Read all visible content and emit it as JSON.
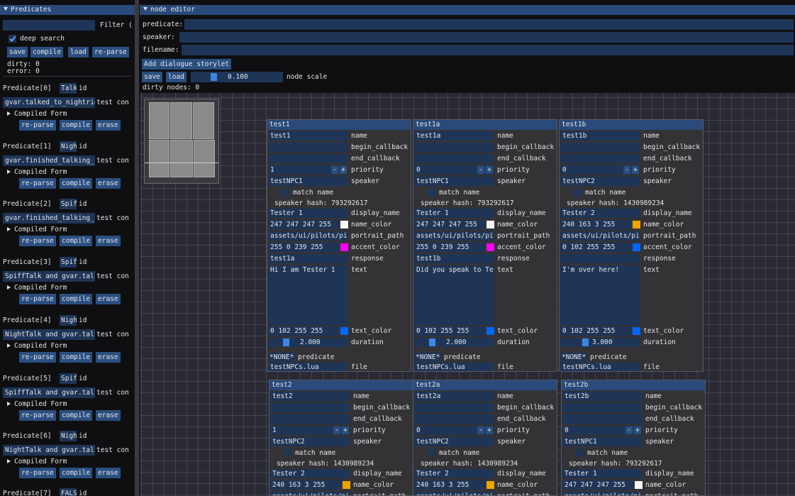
{
  "left": {
    "title": "Predicates",
    "filter_label": "Filter (",
    "deep_search": "deep search",
    "buttons": [
      "save",
      "compile",
      "load",
      "re-parse"
    ],
    "dirty": "dirty: 0",
    "error": "error: 0",
    "predicates": [
      {
        "header": "Predicate[0]",
        "tag": "Talk",
        "id": "id",
        "expr": "gvar.talked_to_nightrid",
        "suffix": "test con",
        "compiled": "Compiled Form"
      },
      {
        "header": "Predicate[1]",
        "tag": "Nigh",
        "id": "id",
        "expr": "gvar.finished_talking_",
        "suffix": "test con",
        "compiled": "Compiled Form"
      },
      {
        "header": "Predicate[2]",
        "tag": "Spif",
        "id": "id",
        "expr": "gvar.finished_talking_",
        "suffix": "test con",
        "compiled": "Compiled Form"
      },
      {
        "header": "Predicate[3]",
        "tag": "Spif",
        "id": "id",
        "expr": "SpiffTalk and gvar.tall",
        "suffix": "test con",
        "compiled": "Compiled Form"
      },
      {
        "header": "Predicate[4]",
        "tag": "Nigh",
        "id": "id",
        "expr": "NightTalk and gvar.tall",
        "suffix": "test con",
        "compiled": "Compiled Form"
      },
      {
        "header": "Predicate[5]",
        "tag": "Spif",
        "id": "id",
        "expr": "SpiffTalk and gvar.tall",
        "suffix": "test con",
        "compiled": "Compiled Form"
      },
      {
        "header": "Predicate[6]",
        "tag": "Nigh",
        "id": "id",
        "expr": "NightTalk and gvar.tall",
        "suffix": "test con",
        "compiled": "Compiled Form"
      },
      {
        "header": "Predicate[7]",
        "tag": "FALS",
        "id": "id"
      }
    ],
    "pred_buttons": [
      "re-parse",
      "compile",
      "erase"
    ]
  },
  "editor": {
    "title": "node editor",
    "predicate_label": "predicate:",
    "speaker_label": "speaker:",
    "filename_label": "filename:",
    "add_button": "Add dialogue storylet",
    "save": "save",
    "load": "load",
    "scale_value": "0.100",
    "scale_label": "node scale",
    "dirty_nodes": "dirty nodes: 0"
  },
  "labels": {
    "name": "name",
    "begin": "begin_callback",
    "end": "end_callback",
    "priority": "priority",
    "speaker": "speaker",
    "match": "match name",
    "display": "display_name",
    "name_color": "name_color",
    "portrait": "portrait_path",
    "accent": "accent_color",
    "response": "response",
    "text": "text",
    "text_color": "text_color",
    "duration": "duration",
    "predicate": "predicate",
    "file": "file",
    "minus": "-",
    "plus": "+"
  },
  "nodes": [
    {
      "title": "test1",
      "name": "test1",
      "priority": "1",
      "speaker": "testNPC1",
      "hash": "speaker hash: 793292617",
      "display": "Tester 1",
      "name_color": "247  247  247  255",
      "name_swatch": "#f7f7f7",
      "portrait": "assets/ui/pilots/pilo",
      "accent": "255    0  239  255",
      "accent_swatch": "#ff00ef",
      "response": "test1a",
      "text": "Hi I am Tester 1",
      "text_color": "0  102  255  255",
      "text_swatch": "#0066ff",
      "duration": "2.000",
      "duration_frac": 0.2,
      "pred": "*NONE*",
      "file": "testNPCs.lua"
    },
    {
      "title": "test1a",
      "name": "test1a",
      "priority": "0",
      "speaker": "testNPC1",
      "hash": "speaker hash: 793292617",
      "display": "Tester 1",
      "name_color": "247  247  247  255",
      "name_swatch": "#f7f7f7",
      "portrait": "assets/ui/pilots/pilo",
      "accent": "255    0  239  255",
      "accent_swatch": "#ff00ef",
      "response": "test1b",
      "text": "Did you speak to Test",
      "text_color": "0  102  255  255",
      "text_swatch": "#0066ff",
      "duration": "2.000",
      "duration_frac": 0.2,
      "pred": "*NONE*",
      "file": "testNPCs.lua"
    },
    {
      "title": "test1b",
      "name": "test1b",
      "priority": "0",
      "speaker": "testNPC2",
      "hash": "speaker hash: 1430989234",
      "display": "Tester 2",
      "name_color": "240  163    3  255",
      "name_swatch": "#f0a303",
      "portrait": "assets/ui/pilots/pilo",
      "accent": "  0  102  255  255",
      "accent_swatch": "#0066ff",
      "response": "",
      "text": "I'm over here!",
      "text_color": "0  102  255  255",
      "text_swatch": "#0066ff",
      "duration": "3.000",
      "duration_frac": 0.3,
      "pred": "*NONE*",
      "file": "testNPCs.lua"
    },
    {
      "title": "test2",
      "name": "test2",
      "priority": "1",
      "speaker": "testNPC2",
      "hash": "speaker hash: 1430989234",
      "display": "Tester 2",
      "name_color": "240  163    3  255",
      "name_swatch": "#f0a303",
      "portrait": "assets/ui/pilots/pilo"
    },
    {
      "title": "test2a",
      "name": "test2a",
      "priority": "0",
      "speaker": "testNPC2",
      "hash": "speaker hash: 1430989234",
      "display": "Tester 2",
      "name_color": "240  163    3  255",
      "name_swatch": "#f0a303",
      "portrait": "assets/ui/pilots/pilo"
    },
    {
      "title": "test2b",
      "name": "test2b",
      "priority": "0",
      "speaker": "testNPC1",
      "hash": "speaker hash: 793292617",
      "display": "Tester 1",
      "name_color": "247  247  247  255",
      "name_swatch": "#f7f7f7",
      "portrait": "assets/ui/pilots/pilo"
    }
  ]
}
